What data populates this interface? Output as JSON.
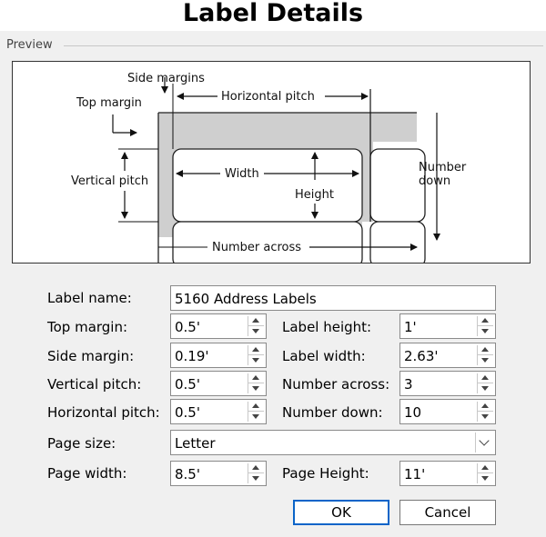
{
  "window": {
    "title": "Label Details"
  },
  "preview": {
    "group_label": "Preview",
    "labels": {
      "side_margins": "Side margins",
      "top_margin": "Top margin",
      "horizontal_pitch": "Horizontal pitch",
      "vertical_pitch": "Vertical pitch",
      "width": "Width",
      "height": "Height",
      "number_down_1": "Number",
      "number_down_2": "down",
      "number_across": "Number across"
    }
  },
  "form": {
    "label_name": {
      "label": "Label name:",
      "value": "5160 Address Labels"
    },
    "top_margin": {
      "label": "Top margin:",
      "value": "0.5'"
    },
    "side_margin": {
      "label": "Side margin:",
      "value": "0.19'"
    },
    "vertical_pitch": {
      "label": "Vertical pitch:",
      "value": "0.5'"
    },
    "horizontal_pitch": {
      "label": "Horizontal pitch:",
      "value": "0.5'"
    },
    "label_height": {
      "label": "Label height:",
      "value": "1'"
    },
    "label_width": {
      "label": "Label width:",
      "value": "2.63'"
    },
    "number_across": {
      "label": "Number across:",
      "value": "3"
    },
    "number_down": {
      "label": "Number down:",
      "value": "10"
    },
    "page_size": {
      "label": "Page size:",
      "value": "Letter"
    },
    "page_width": {
      "label": "Page width:",
      "value": "8.5'"
    },
    "page_height": {
      "label": "Page Height:",
      "value": "11'"
    }
  },
  "buttons": {
    "ok": "OK",
    "cancel": "Cancel"
  }
}
